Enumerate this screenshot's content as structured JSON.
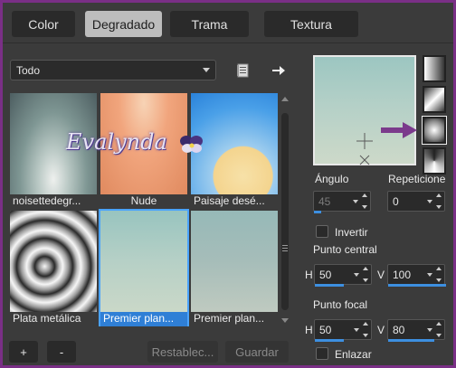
{
  "tabs": [
    {
      "label": "Color",
      "active": false
    },
    {
      "label": "Degradado",
      "active": true
    },
    {
      "label": "Trama",
      "active": false
    },
    {
      "label": "Textura",
      "active": false
    }
  ],
  "filter": {
    "selected": "Todo"
  },
  "icons": {
    "import": "document-icon",
    "export": "arrow-right-icon"
  },
  "gallery": {
    "items": [
      {
        "caption": "noisettedegr..."
      },
      {
        "caption": "Nude"
      },
      {
        "caption": "Paisaje desé..."
      },
      {
        "caption": "Plata metálica"
      },
      {
        "caption": "Premier plan...",
        "selected": true
      },
      {
        "caption": "Premier plan..."
      }
    ],
    "watermark": "Evalynda"
  },
  "buttons": {
    "add": "+",
    "remove": "-",
    "reset": "Restablec...",
    "save": "Guardar"
  },
  "right": {
    "angle_label": "Ángulo",
    "angle_value": "45",
    "repeat_label": "Repeticione",
    "repeat_value": "0",
    "invert_label": "Invertir",
    "center_label": "Punto central",
    "center_h_label": "H",
    "center_h": "50",
    "center_v_label": "V",
    "center_v": "100",
    "focal_label": "Punto focal",
    "focal_h_label": "H",
    "focal_h": "50",
    "focal_v_label": "V",
    "focal_v": "80",
    "link_label": "Enlazar"
  },
  "colors": {
    "frame": "#7a2f86",
    "panel": "#3b3b3b",
    "accent": "#3d8fe0",
    "arrow": "#7b3a8c"
  }
}
